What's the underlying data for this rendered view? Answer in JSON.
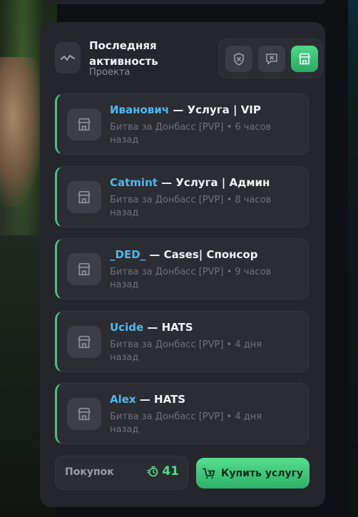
{
  "header": {
    "title": "Последняя активность",
    "subtitle": "Проекта",
    "icon": "activity-wave-icon"
  },
  "filters": [
    {
      "icon": "shield-x-icon",
      "active": false
    },
    {
      "icon": "message-x-icon",
      "active": false
    },
    {
      "icon": "store-icon",
      "active": true
    }
  ],
  "activity": [
    {
      "user": "Иванович",
      "service": " — Услуга | VIP",
      "server": "Битва за Донбасс [PVP]",
      "time": " • 6 часов назад"
    },
    {
      "user": "Catmint",
      "service": " — Услуга | Админ",
      "server": "Битва за Донбасс [PVP]",
      "time": " • 8 часов назад"
    },
    {
      "user": "_DED_",
      "service": " — Cases| Спонсор",
      "server": "Битва за Донбасс [PVP]",
      "time": " • 9 часов назад"
    },
    {
      "user": "Ucide",
      "service": " — HATS",
      "server": "Битва за Донбасс [PVP]",
      "time": " • 4 дня назад"
    },
    {
      "user": "Alex",
      "service": " — HATS",
      "server": "Битва за Донбасс [PVP]",
      "time": " • 4 дня назад"
    }
  ],
  "footer": {
    "purchases_label": "Покупок",
    "purchases_count": "41",
    "buy_label": "Купить услугу"
  },
  "colors": {
    "accent": "#3ec77d",
    "username": "#4db8ee",
    "panel": "#25262c"
  }
}
